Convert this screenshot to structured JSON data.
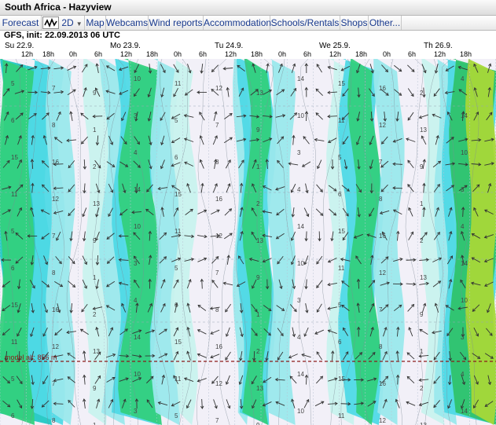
{
  "window": {
    "title": "South Africa - Hazyview"
  },
  "nav": {
    "items": [
      "Forecast",
      "2D",
      "Map",
      "Webcams",
      "Wind reports",
      "Accommodation",
      "Schools/Rentals",
      "Shops",
      "Other..."
    ],
    "graph_icon": "line-graph-icon",
    "dropdown_icon": "chevron-down-icon"
  },
  "model": {
    "info": "GFS, init: 22.09.2013 06 UTC"
  },
  "days": [
    "Su 22.9.",
    "Mo 23.9.",
    "Tu 24.9.",
    "We 25.9.",
    "Th 26.9."
  ],
  "hours": [
    "12h",
    "18h",
    "0h",
    "6h",
    "12h",
    "18h",
    "0h",
    "6h",
    "12h",
    "18h",
    "0h",
    "6h",
    "12h",
    "18h",
    "0h",
    "6h",
    "12h",
    "18h"
  ],
  "model_alt": {
    "label": "model alt: 856 m"
  },
  "contour_labels": [
    "3",
    "5",
    "7",
    "9",
    "10",
    "11",
    "12",
    "13",
    "14",
    "15",
    "16",
    "2",
    "4",
    "6",
    "8",
    "1"
  ],
  "colors": {
    "lavender": "#f2f0f8",
    "pale_aqua": "#c8f2ee",
    "light_aqua": "#9ae8ec",
    "aqua": "#4fd9e6",
    "teal": "#22c8c4",
    "green": "#33d07e",
    "bright_green": "#2fc36b",
    "yellow_green": "#a6d838",
    "alt_line": "#8b1a1a",
    "nav_text": "#1a3b8f"
  }
}
